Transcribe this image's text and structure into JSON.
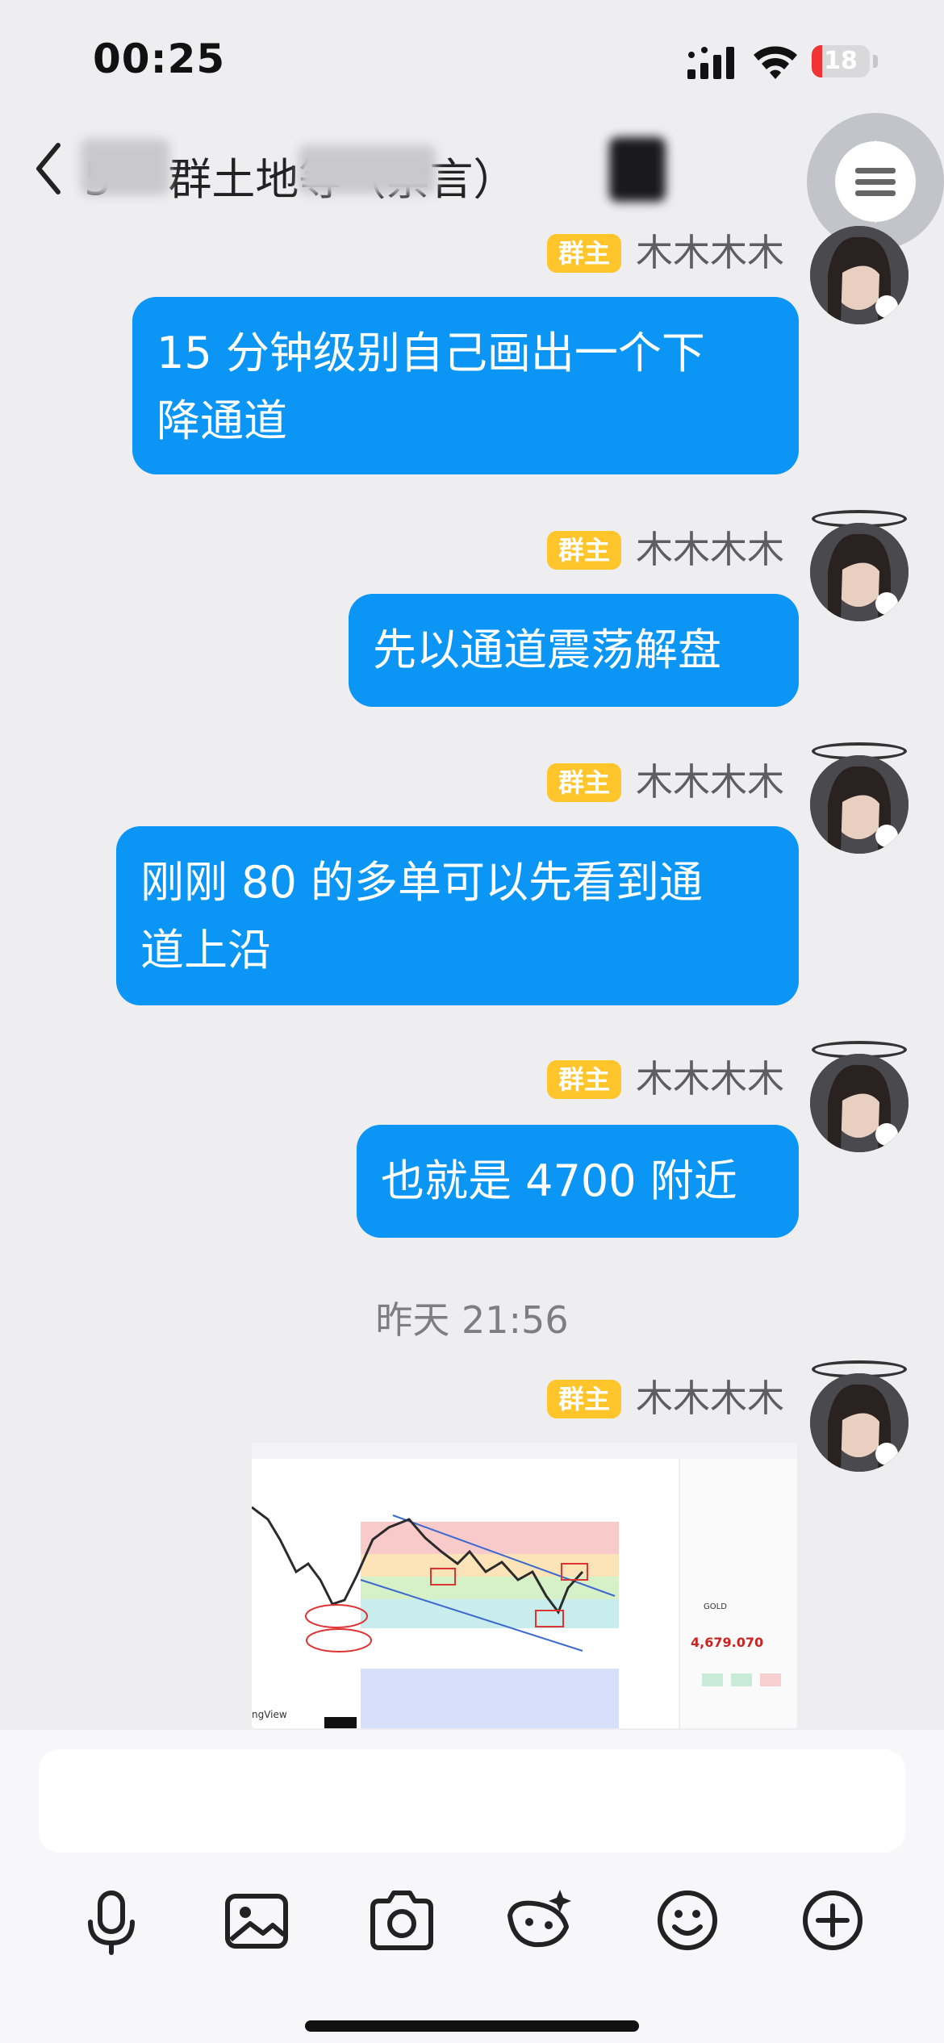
{
  "status_bar": {
    "time": "00:25",
    "battery": "18",
    "battery_level": 0.18,
    "battery_color": "#f03434"
  },
  "header": {
    "title_start": "5",
    "title_visible": "群土地等",
    "title_tag": "（禁言）"
  },
  "colors": {
    "bubble": "#0b95f4",
    "badge": "#ffc52b",
    "background": "#eeeef1"
  },
  "messages": [
    {
      "badge": "群主",
      "sender": "木木木木",
      "text_lines": [
        "15 分钟级别自己画出一个下",
        "降通道"
      ]
    },
    {
      "badge": "群主",
      "sender": "木木木木",
      "text_lines": [
        "先以通道震荡解盘"
      ]
    },
    {
      "badge": "群主",
      "sender": "木木木木",
      "text_lines": [
        "刚刚 80 的多单可以先看到通",
        "道上沿"
      ]
    },
    {
      "badge": "群主",
      "sender": "木木木木",
      "text_lines": [
        "也就是 4700 附近"
      ]
    }
  ],
  "timestamp": "昨天 21:56",
  "image_message": {
    "badge": "群主",
    "sender": "木木木木",
    "chart": {
      "price": "4,679.070",
      "symbol": "GOLD",
      "watermark": "ngView"
    }
  },
  "toolbar": {
    "icons": [
      "microphone-icon",
      "image-icon",
      "camera-icon",
      "sticker-icon",
      "emoji-icon",
      "plus-icon"
    ]
  }
}
